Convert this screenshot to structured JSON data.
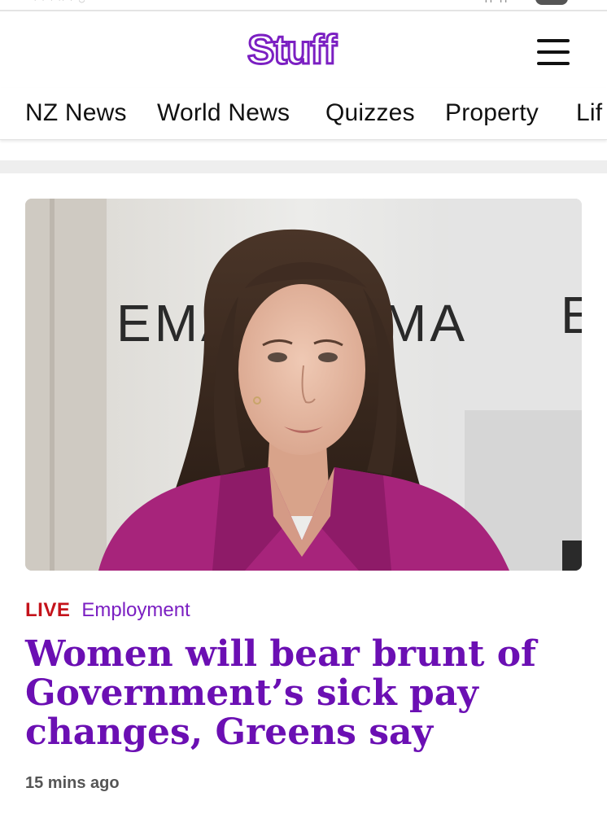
{
  "app": {
    "brand": "Stuff",
    "brand_color": "#7b1fc2"
  },
  "header": {
    "menu_icon": "hamburger-menu-icon"
  },
  "nav": {
    "items": [
      {
        "label": "NZ News"
      },
      {
        "label": "World News"
      },
      {
        "label": "Quizzes"
      },
      {
        "label": "Property"
      },
      {
        "label": "Lif"
      }
    ]
  },
  "article": {
    "live_label": "LIVE",
    "topic": "Employment",
    "headline": "Women will bear brunt of Government’s sick pay changes, Greens say",
    "time_ago": "15 mins ago",
    "image": {
      "description": "Woman in magenta blazer speaking in front of EMA branded backdrop",
      "backdrop_text_left": "EMA",
      "backdrop_text_right": "MA",
      "backdrop_text_edge": "E"
    }
  },
  "colors": {
    "live": "#c4131b",
    "topic": "#7b1fc2",
    "headline": "#6b0fb3"
  }
}
